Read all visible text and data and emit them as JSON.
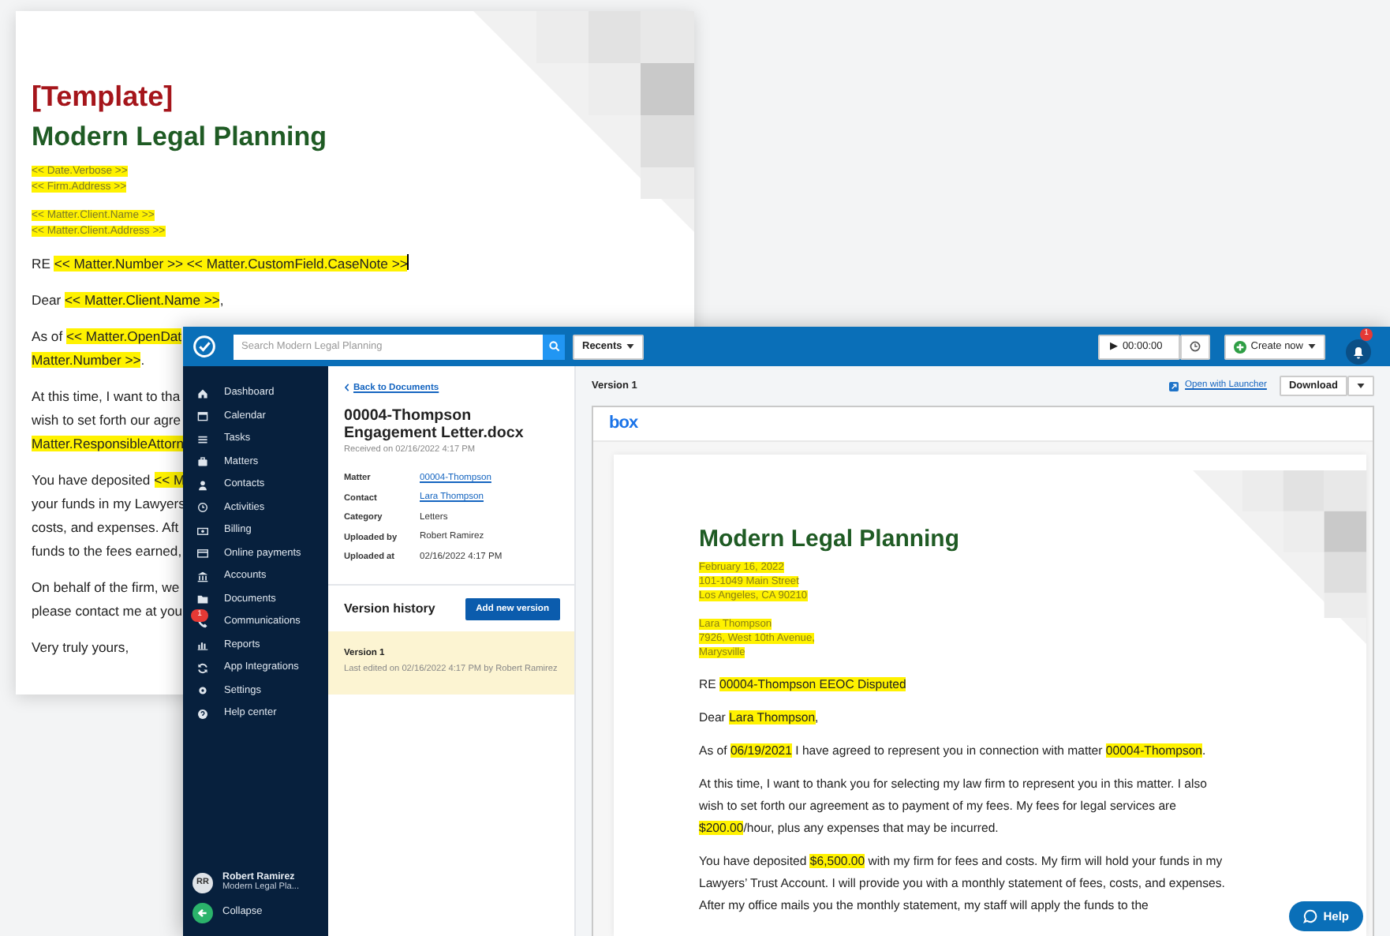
{
  "background_document": {
    "heading": "[Template]",
    "title": "Modern Legal Planning",
    "address_blocks": [
      [
        "<< Date.Verbose >>",
        "<< Firm.Address >>"
      ],
      [
        "<< Matter.Client.Name >>",
        "<< Matter.Client.Address >>"
      ]
    ],
    "paragraphs": [
      {
        "lines": [
          [
            {
              "text": "RE ",
              "highlighted": false
            },
            {
              "text": "<< Matter.Number >> << Matter.CustomField.CaseNote >>",
              "highlighted": true
            }
          ]
        ],
        "cursor": true
      },
      {
        "lines": [
          [
            {
              "text": "Dear ",
              "highlighted": false
            },
            {
              "text": "<< Matter.Client.Name >>",
              "highlighted": true
            },
            {
              "text": ",",
              "highlighted": false
            }
          ]
        ]
      },
      {
        "lines": [
          [
            {
              "text": "As of ",
              "highlighted": false
            },
            {
              "text": "<< Matter.OpenDat",
              "highlighted": true
            }
          ],
          [
            {
              "text": "Matter.Number >>",
              "highlighted": true
            },
            {
              "text": ".",
              "highlighted": false
            }
          ]
        ]
      },
      {
        "lines": [
          [
            {
              "text": "At this time, I want to tha",
              "highlighted": false
            }
          ],
          [
            {
              "text": "wish to set forth our agre",
              "highlighted": false
            }
          ],
          [
            {
              "text": "Matter.ResponsibleAttorn",
              "highlighted": true
            }
          ]
        ]
      },
      {
        "lines": [
          [
            {
              "text": "You have deposited ",
              "highlighted": false
            },
            {
              "text": "<< M",
              "highlighted": true
            }
          ],
          [
            {
              "text": "your funds in my Lawyers",
              "highlighted": false
            }
          ],
          [
            {
              "text": "costs, and expenses. Aft",
              "highlighted": false
            }
          ],
          [
            {
              "text": "funds to the fees earned,",
              "highlighted": false
            }
          ]
        ]
      },
      {
        "lines": [
          [
            {
              "text": "On behalf of the firm, we",
              "highlighted": false
            }
          ],
          [
            {
              "text": "please contact me at you",
              "highlighted": false
            }
          ]
        ]
      },
      {
        "lines": [
          [
            {
              "text": "Very truly yours,",
              "highlighted": false
            }
          ]
        ]
      }
    ]
  },
  "topbar": {
    "search": {
      "placeholder": "Search Modern Legal Planning"
    },
    "recents": "Recents",
    "timer": "00:00:00",
    "play": "▶",
    "create": "Create now",
    "notifications_badge": "1"
  },
  "sidebar": {
    "items": [
      {
        "label": "Dashboard"
      },
      {
        "label": "Calendar"
      },
      {
        "label": "Tasks"
      },
      {
        "label": "Matters"
      },
      {
        "label": "Contacts"
      },
      {
        "label": "Activities"
      },
      {
        "label": "Billing"
      },
      {
        "label": "Online payments"
      },
      {
        "label": "Accounts"
      },
      {
        "label": "Documents"
      },
      {
        "label": "Communications",
        "badge": "1"
      },
      {
        "label": "Reports"
      },
      {
        "label": "App Integrations"
      },
      {
        "label": "Settings"
      },
      {
        "label": "Help center"
      }
    ],
    "user": {
      "initials": "RR",
      "name": "Robert Ramirez",
      "firm": "Modern Legal Pla..."
    },
    "collapse": "Collapse"
  },
  "details": {
    "back_link": "Back to Documents",
    "title": "00004-Thompson Engagement Letter.docx",
    "received": "Received on 02/16/2022 4:17 PM",
    "fields": [
      {
        "label": "Matter",
        "value": "00004-Thompson",
        "link": true
      },
      {
        "label": "Contact",
        "value": "Lara Thompson",
        "link": true
      },
      {
        "label": "Category",
        "value": "Letters",
        "link": false
      },
      {
        "label": "Uploaded by",
        "value": "Robert Ramirez",
        "link": false
      },
      {
        "label": "Uploaded at",
        "value": "02/16/2022 4:17 PM",
        "link": false
      }
    ],
    "version_history": {
      "title": "Version history",
      "button": "Add new version",
      "versions": [
        {
          "name": "Version 1",
          "note": "Last edited on 02/16/2022 4:17 PM by Robert Ramirez",
          "selected": true
        }
      ]
    }
  },
  "preview": {
    "title": "Version 1",
    "open_link": "Open with Launcher",
    "download": "Download",
    "viewer_logo": "box",
    "letter": {
      "title": "Modern Legal Planning",
      "address_blocks": [
        [
          "February 16, 2022",
          "101-1049 Main Street",
          "Los Angeles, CA 90210"
        ],
        [
          "Lara Thompson",
          "7926, West 10th Avenue,",
          "Marysville"
        ]
      ],
      "paragraphs": [
        [
          {
            "text": "RE ",
            "highlighted": false
          },
          {
            "text": "00004-Thompson EEOC Disputed",
            "highlighted": true
          }
        ],
        [
          {
            "text": "Dear ",
            "highlighted": false
          },
          {
            "text": "Lara Thompson",
            "highlighted": true
          },
          {
            "text": ",",
            "highlighted": false
          }
        ],
        [
          {
            "text": "As of ",
            "highlighted": false
          },
          {
            "text": "06/19/2021",
            "highlighted": true
          },
          {
            "text": " I have agreed to represent you in connection with matter ",
            "highlighted": false
          },
          {
            "text": "00004-Thompson",
            "highlighted": true
          },
          {
            "text": ".",
            "highlighted": false
          }
        ],
        [
          {
            "text": "At this time, I want to thank you for selecting my law firm to represent you in this matter. I also wish to set forth our agreement as to payment of my fees. My fees for legal services are ",
            "highlighted": false
          },
          {
            "text": "$200.00",
            "highlighted": true
          },
          {
            "text": "/hour, plus any expenses that may be incurred.",
            "highlighted": false
          }
        ],
        [
          {
            "text": "You have deposited ",
            "highlighted": false
          },
          {
            "text": "$6,500.00",
            "highlighted": true
          },
          {
            "text": " with my firm for fees and costs. My firm will hold your funds in my Lawyers’ Trust Account. I will provide you with a monthly statement of fees, costs, and expenses. After my office mails you the monthly statement, my staff will apply the funds to the",
            "highlighted": false
          }
        ]
      ]
    },
    "help": "Help"
  }
}
